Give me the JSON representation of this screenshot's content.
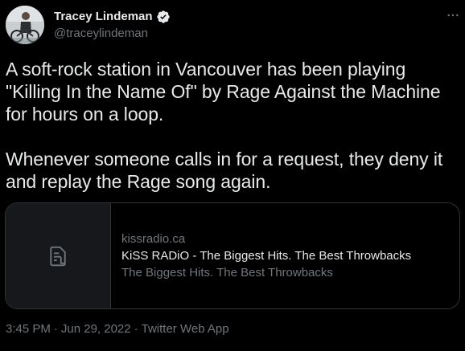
{
  "author": {
    "display_name": "Tracey Lindeman",
    "handle": "@traceylindeman",
    "verified": true
  },
  "tweet": {
    "paragraphs": [
      "A soft-rock station in Vancouver has been playing \"Killing In the Name Of\" by Rage Against the Machine for hours on a loop.",
      "Whenever someone calls in for a request, they deny it and replay the Rage song again."
    ]
  },
  "card": {
    "domain": "kissradio.ca",
    "title": "KiSS RADiO - The Biggest Hits. The Best Throwbacks",
    "description": "The Biggest Hits. The Best Throwbacks",
    "thumbnail_icon": "document-icon"
  },
  "meta": {
    "time": "3:45 PM",
    "date": "Jun 29, 2022",
    "separator": "·",
    "source": "Twitter Web App"
  },
  "icons": {
    "more": "more-icon",
    "verified": "verified-badge-icon"
  },
  "colors": {
    "background": "#000000",
    "text_primary": "#e7e9ea",
    "text_secondary": "#71767b",
    "border": "#2f3336",
    "verified_badge": "#1d9bf0"
  }
}
